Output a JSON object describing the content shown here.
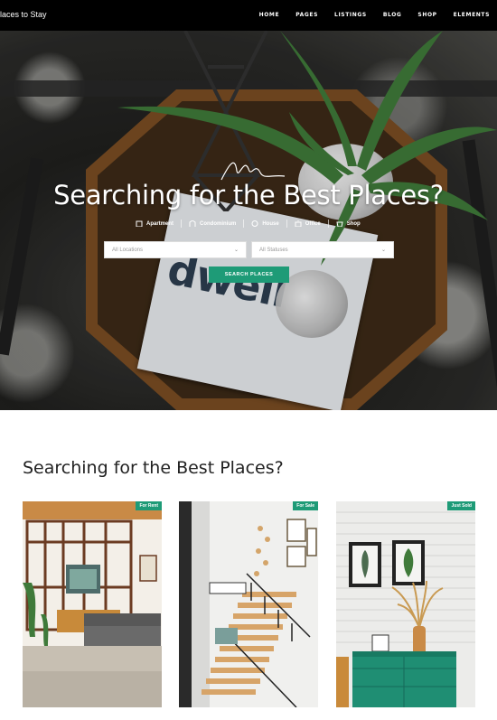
{
  "header": {
    "logo_text": "laces to Stay",
    "nav": [
      "HOME",
      "PAGES",
      "LISTINGS",
      "BLOG",
      "SHOP",
      "ELEMENTS"
    ]
  },
  "hero": {
    "title": "Searching for the Best Places?",
    "types": [
      {
        "label": "Apartment",
        "icon": "building-icon"
      },
      {
        "label": "Condominium",
        "icon": "condo-icon"
      },
      {
        "label": "House",
        "icon": "house-icon"
      },
      {
        "label": "Office",
        "icon": "office-icon"
      },
      {
        "label": "Shop",
        "icon": "shop-icon"
      }
    ],
    "location_select": "All Locations",
    "status_select": "All Statuses",
    "search_button": "SEARCH PLACES"
  },
  "section": {
    "title": "Searching for the Best Places?"
  },
  "cards": [
    {
      "badge": "For Rent"
    },
    {
      "badge": "For Sale"
    },
    {
      "badge": "Just Sold"
    }
  ],
  "colors": {
    "accent": "#1e9b77",
    "nav_bg": "#000000"
  }
}
